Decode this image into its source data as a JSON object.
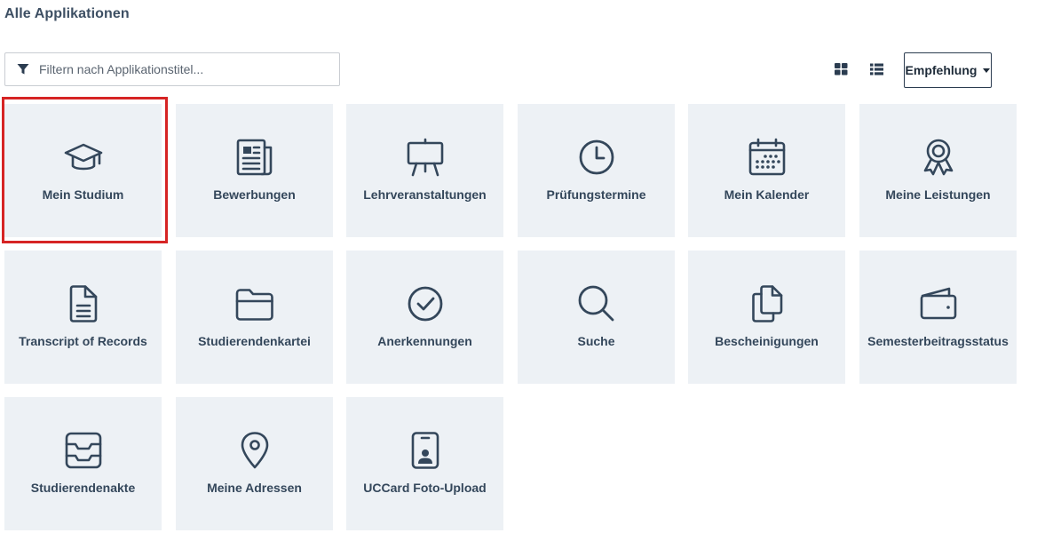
{
  "page_title": "Alle Applikationen",
  "filter": {
    "placeholder": "Filtern nach Applikationstitel...",
    "value": ""
  },
  "view_toggle": {
    "grid_icon": "grid-view-icon",
    "list_icon": "list-view-icon"
  },
  "sort": {
    "label": "Empfehlung"
  },
  "colors": {
    "tile_bg": "#edf1f5",
    "icon": "#34475b",
    "highlight": "#d62424"
  },
  "tiles": [
    {
      "label": "Mein Studium",
      "icon": "graduation-cap-icon"
    },
    {
      "label": "Bewerbungen",
      "icon": "newspaper-icon"
    },
    {
      "label": "Lehrveranstaltungen",
      "icon": "easel-icon"
    },
    {
      "label": "Prüfungstermine",
      "icon": "clock-icon"
    },
    {
      "label": "Mein Kalender",
      "icon": "calendar-icon"
    },
    {
      "label": "Meine Leistungen",
      "icon": "award-icon"
    },
    {
      "label": "Transcript of Records",
      "icon": "document-icon"
    },
    {
      "label": "Studierendenkartei",
      "icon": "folder-icon"
    },
    {
      "label": "Anerkennungen",
      "icon": "check-circle-icon"
    },
    {
      "label": "Suche",
      "icon": "search-icon"
    },
    {
      "label": "Bescheinigungen",
      "icon": "copy-files-icon"
    },
    {
      "label": "Semesterbeitragsstatus",
      "icon": "wallet-icon"
    },
    {
      "label": "Studierendenakte",
      "icon": "inbox-icon"
    },
    {
      "label": "Meine Adressen",
      "icon": "map-pin-icon"
    },
    {
      "label": "UCCard Foto-Upload",
      "icon": "id-card-icon"
    }
  ]
}
